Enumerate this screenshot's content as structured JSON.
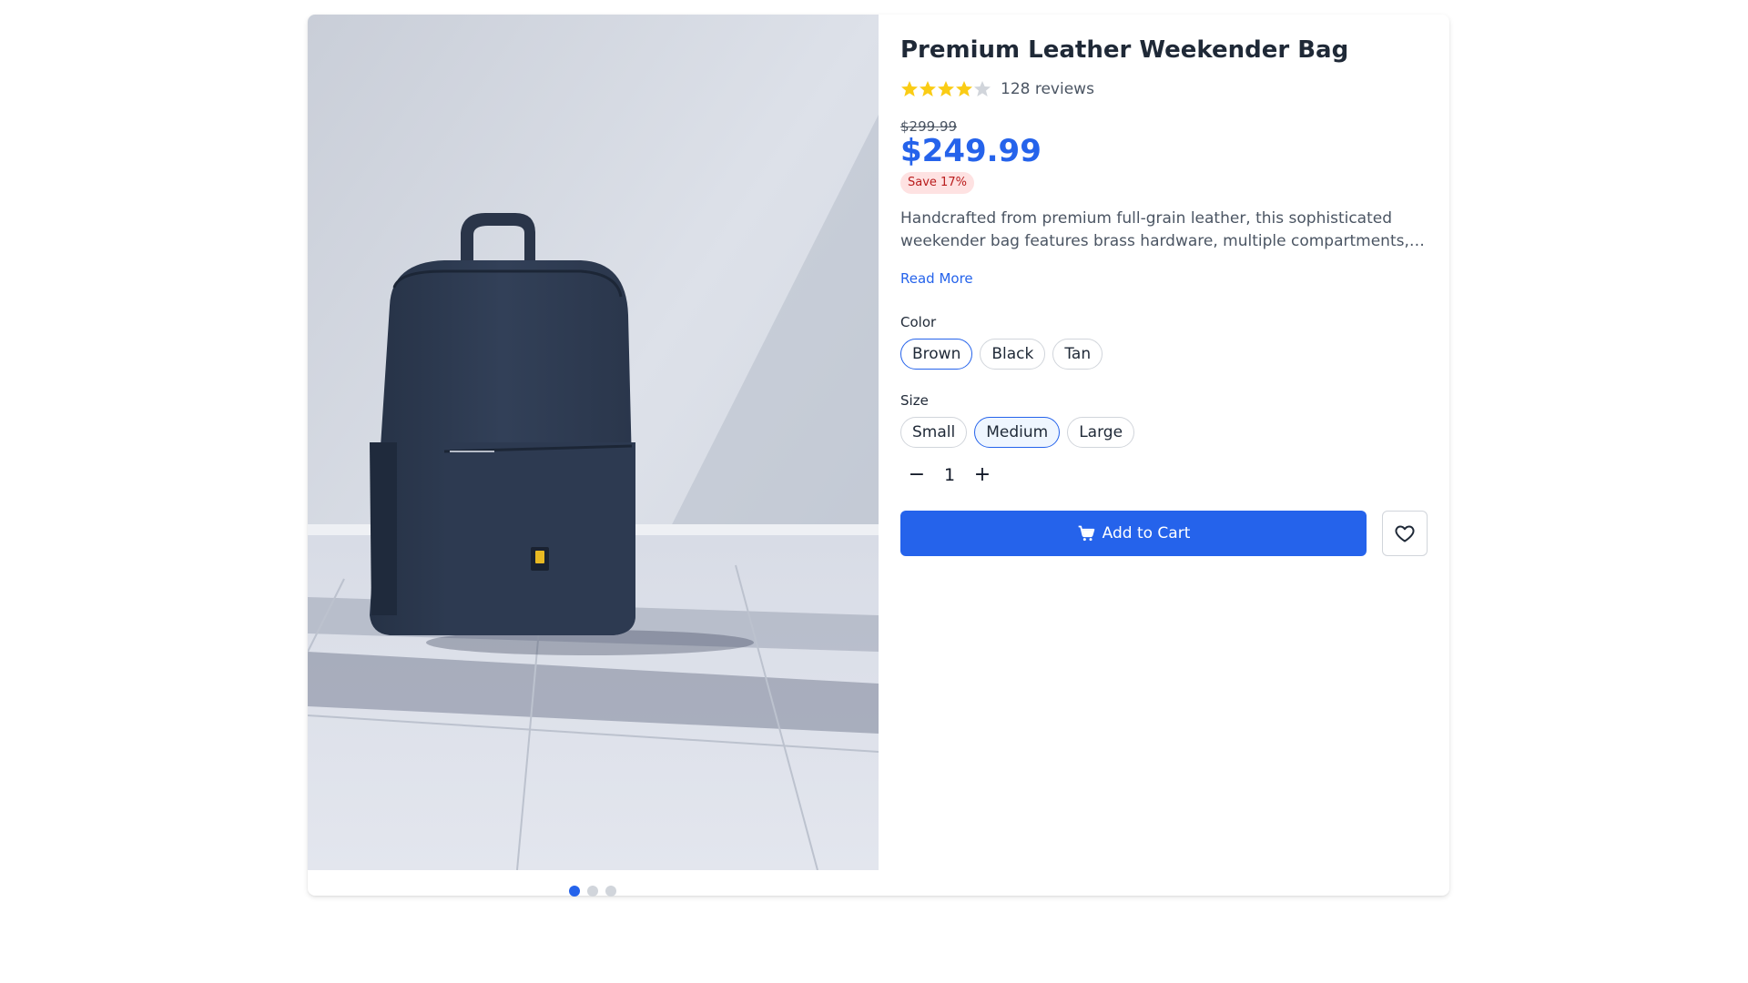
{
  "product": {
    "title": "Premium Leather Weekender Bag",
    "rating": 4,
    "rating_max": 5,
    "reviews_label": "128 reviews",
    "old_price": "$299.99",
    "price": "$249.99",
    "save_label": "Save 17%",
    "description_line1": "Handcrafted from premium full-grain leather, this sophisticated",
    "description_line2": "weekender bag features brass hardware, multiple compartments, an...",
    "read_more": "Read More"
  },
  "gallery": {
    "image_count": 3,
    "active_index": 0
  },
  "options": {
    "color_label": "Color",
    "colors": [
      "Brown",
      "Black",
      "Tan"
    ],
    "selected_color": "Brown",
    "size_label": "Size",
    "sizes": [
      "Small",
      "Medium",
      "Large"
    ],
    "selected_size": "Medium"
  },
  "quantity": {
    "minus": "−",
    "value": "1",
    "plus": "+"
  },
  "actions": {
    "add_to_cart": "Add to Cart"
  },
  "colors": {
    "accent": "#2563eb",
    "star_filled": "#facc15",
    "star_empty": "#d1d5db",
    "badge_bg": "#fee2e2",
    "badge_text": "#b91c1c"
  }
}
